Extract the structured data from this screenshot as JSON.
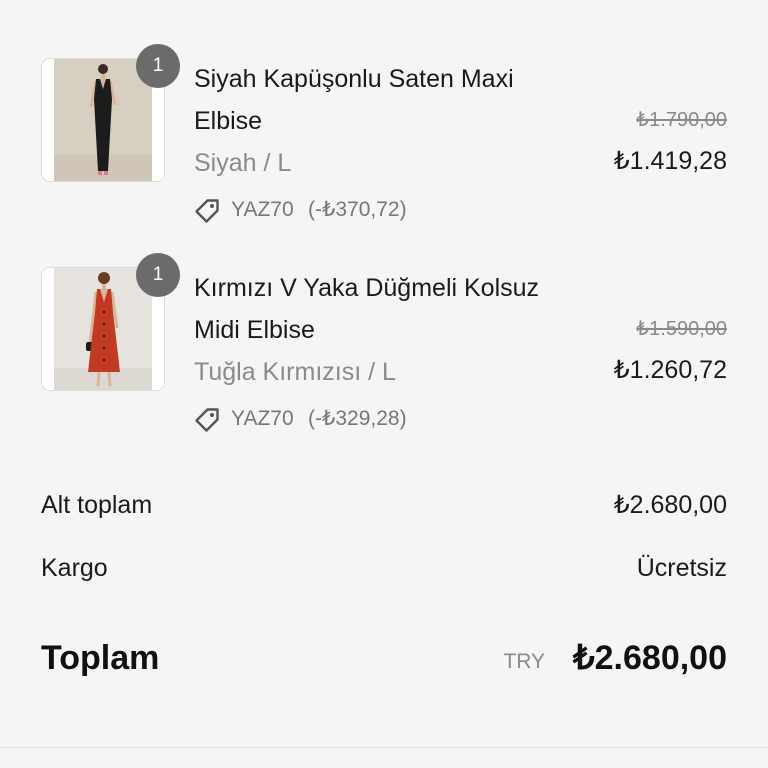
{
  "items": [
    {
      "quantity": "1",
      "title_line1": "Siyah Kapüşonlu Saten Maxi",
      "title_line2": "Elbise",
      "variant": "Siyah / L",
      "discount_code": "YAZ70",
      "discount_amount": "(-₺370,72)",
      "original_price": "₺1.790,00",
      "current_price": "₺1.419,28",
      "image": "black-satin-maxi-dress-photo",
      "colors": {
        "background": "#d8cfc3",
        "garment": "#1c1c1c"
      }
    },
    {
      "quantity": "1",
      "title_line1": "Kırmızı V Yaka Düğmeli Kolsuz",
      "title_line2": "Midi Elbise",
      "variant": "Tuğla Kırmızısı / L",
      "discount_code": "YAZ70",
      "discount_amount": "(-₺329,28)",
      "original_price": "₺1.590,00",
      "current_price": "₺1.260,72",
      "image": "red-button-midi-dress-photo",
      "colors": {
        "background": "#e6e3df",
        "garment": "#c23a22"
      }
    }
  ],
  "totals": {
    "subtotal_label": "Alt toplam",
    "subtotal_value": "₺2.680,00",
    "shipping_label": "Kargo",
    "shipping_value": "Ücretsiz",
    "total_label": "Toplam",
    "currency_code": "TRY",
    "total_value": "₺2.680,00"
  },
  "icons": {
    "discount": "tag-icon"
  },
  "colors": {
    "page_background": "#f5f5f5",
    "badge": "#6b6b6b",
    "muted_text": "#8a8a8a"
  }
}
